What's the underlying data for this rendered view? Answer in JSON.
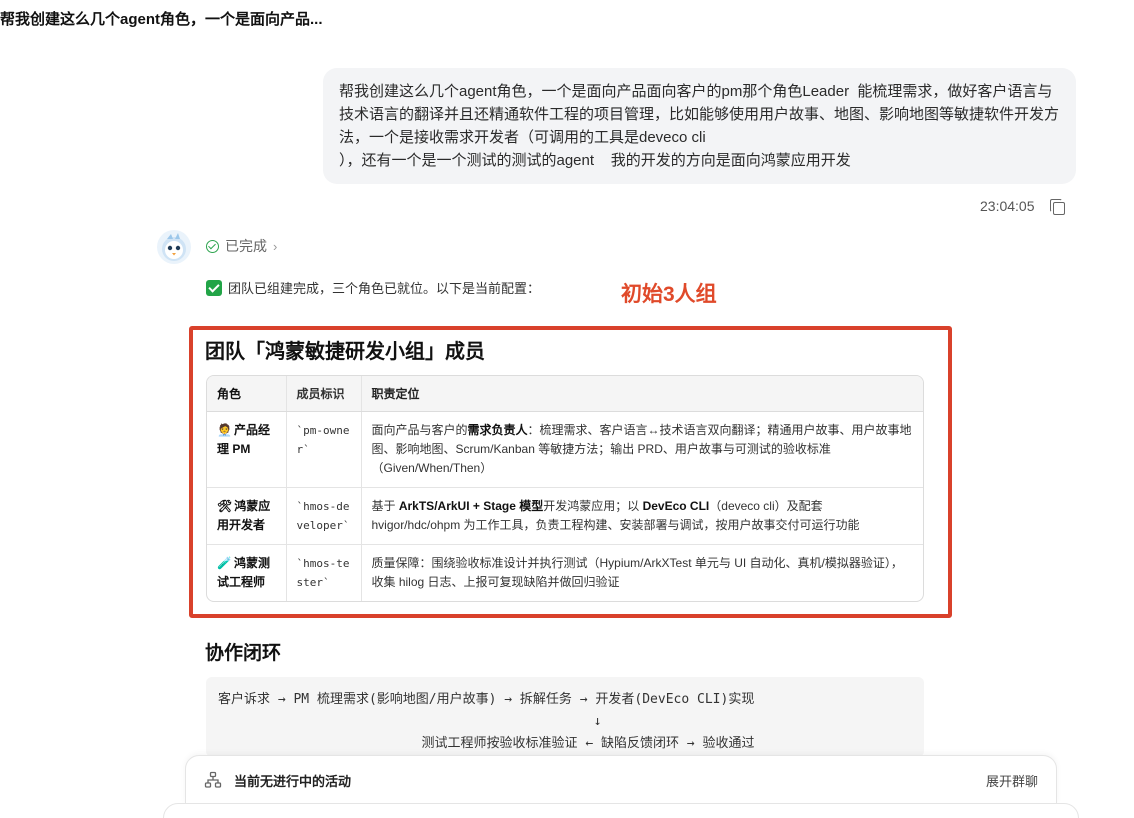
{
  "top_title": "帮我创建这么几个agent角色，一个是面向产品...",
  "user_message": "帮我创建这么几个agent角色，一个是面向产品面向客户的pm那个角色Leader  能梳理需求，做好客户语言与技术语言的翻译并且还精通软件工程的项目管理，比如能够使用用户故事、地图、影响地图等敏捷软件开发方法，一个是接收需求开发者（可调用的工具是deveco cli\n），还有一个是一个测试的测试的agent    我的开发的方向是面向鸿蒙应用开发",
  "message_time": "23:04:05",
  "status": {
    "label": "已完成",
    "icon": "check-circle-icon"
  },
  "done_text": "团队已组建完成，三个角色已就位。以下是当前配置：",
  "annotation": {
    "text": "初始3人组",
    "color": "#e04a2a"
  },
  "team_title": "团队「鸿蒙敏捷研发小组」成员",
  "table": {
    "headers": [
      "角色",
      "成员标识",
      "职责定位"
    ],
    "rows": [
      {
        "emoji": "🧑‍💼",
        "role": "产品经理 PM",
        "id": "`pm-owner`",
        "duty_parts": [
          "面向产品与客户的",
          "需求负责人",
          "：梳理需求、客户语言↔技术语言双向翻译；精通用户故事、用户故事地图、影响地图、Scrum/Kanban 等敏捷方法；输出 PRD、用户故事与可测试的验收标准（Given/When/Then）"
        ]
      },
      {
        "emoji": "🛠",
        "role": "鸿蒙应用开发者",
        "id": "`hmos-developer`",
        "duty_parts": [
          "基于 ",
          "ArkTS/ArkUI + Stage 模型",
          "开发鸿蒙应用；以 ",
          "DevEco CLI",
          "（deveco cli）及配套 hvigor/hdc/ohpm 为工作工具，负责工程构建、安装部署与调试，按用户故事交付可运行功能"
        ]
      },
      {
        "emoji": "🧪",
        "role": "鸿蒙测试工程师",
        "id": "`hmos-tester`",
        "duty_parts": [
          "质量保障：围绕验收标准设计并执行测试（Hypium/ArkXTest 单元与 UI 自动化、真机/模拟器验证），收集 hilog 日志、上报可复现缺陷并做回归验证"
        ]
      }
    ]
  },
  "collab_title": "协作闭环",
  "collab_lines": [
    "客户诉求 → PM 梳理需求(影响地图/用户故事) → 拆解任务 → 开发者(DevEco CLI)实现",
    "                                                ↓",
    "                          测试工程师按验收标准验证 ← 缺陷反馈闭环 → 验收通过"
  ],
  "activity": {
    "label": "当前无进行中的活动",
    "expand": "展开群聊"
  }
}
